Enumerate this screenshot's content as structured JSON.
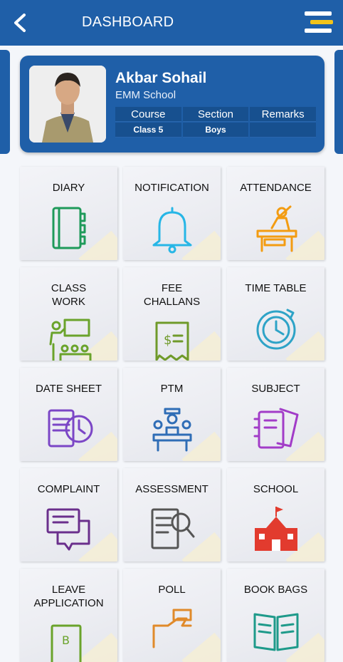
{
  "header": {
    "title": "DASHBOARD"
  },
  "profile": {
    "name": "Akbar Sohail",
    "school": "EMM School",
    "columns": [
      "Course",
      "Section",
      "Remarks"
    ],
    "values": [
      "Class 5",
      "Boys",
      ""
    ]
  },
  "menu_tiles": [
    {
      "label": "DIARY",
      "icon": "diary-icon",
      "color": "#1e9a5a"
    },
    {
      "label": "NOTIFICATION",
      "icon": "bell-icon",
      "color": "#27b6e6"
    },
    {
      "label": "ATTENDANCE",
      "icon": "attendance-icon",
      "color": "#f39c12"
    },
    {
      "label": "CLASS\nWORK",
      "icon": "classroom-icon",
      "color": "#6aa32b"
    },
    {
      "label": "FEE\nCHALLANS",
      "icon": "receipt-icon",
      "color": "#6f9a2a"
    },
    {
      "label": "TIME TABLE",
      "icon": "clock-icon",
      "color": "#2ea3c7"
    },
    {
      "label": "DATE SHEET",
      "icon": "date-sheet-icon",
      "color": "#7b46c6"
    },
    {
      "label": "PTM",
      "icon": "meeting-icon",
      "color": "#2f6db6"
    },
    {
      "label": "SUBJECT",
      "icon": "notebook-icon",
      "color": "#a23cc8"
    },
    {
      "label": "COMPLAINT",
      "icon": "chat-icon",
      "color": "#6a2f8c"
    },
    {
      "label": "ASSESSMENT",
      "icon": "magnifier-doc-icon",
      "color": "#555555"
    },
    {
      "label": "SCHOOL",
      "icon": "school-building-icon",
      "color": "#e23b2e"
    },
    {
      "label": "LEAVE\nAPPLICATION",
      "icon": "leave-doc-icon",
      "color": "#6aa32b"
    },
    {
      "label": "POLL",
      "icon": "hand-ballot-icon",
      "color": "#e08a2a"
    },
    {
      "label": "BOOK BAGS",
      "icon": "open-book-icon",
      "color": "#1e9a8a"
    }
  ],
  "colors": {
    "primary": "#1f5fa8",
    "menu_accent": "#f2c31a"
  }
}
